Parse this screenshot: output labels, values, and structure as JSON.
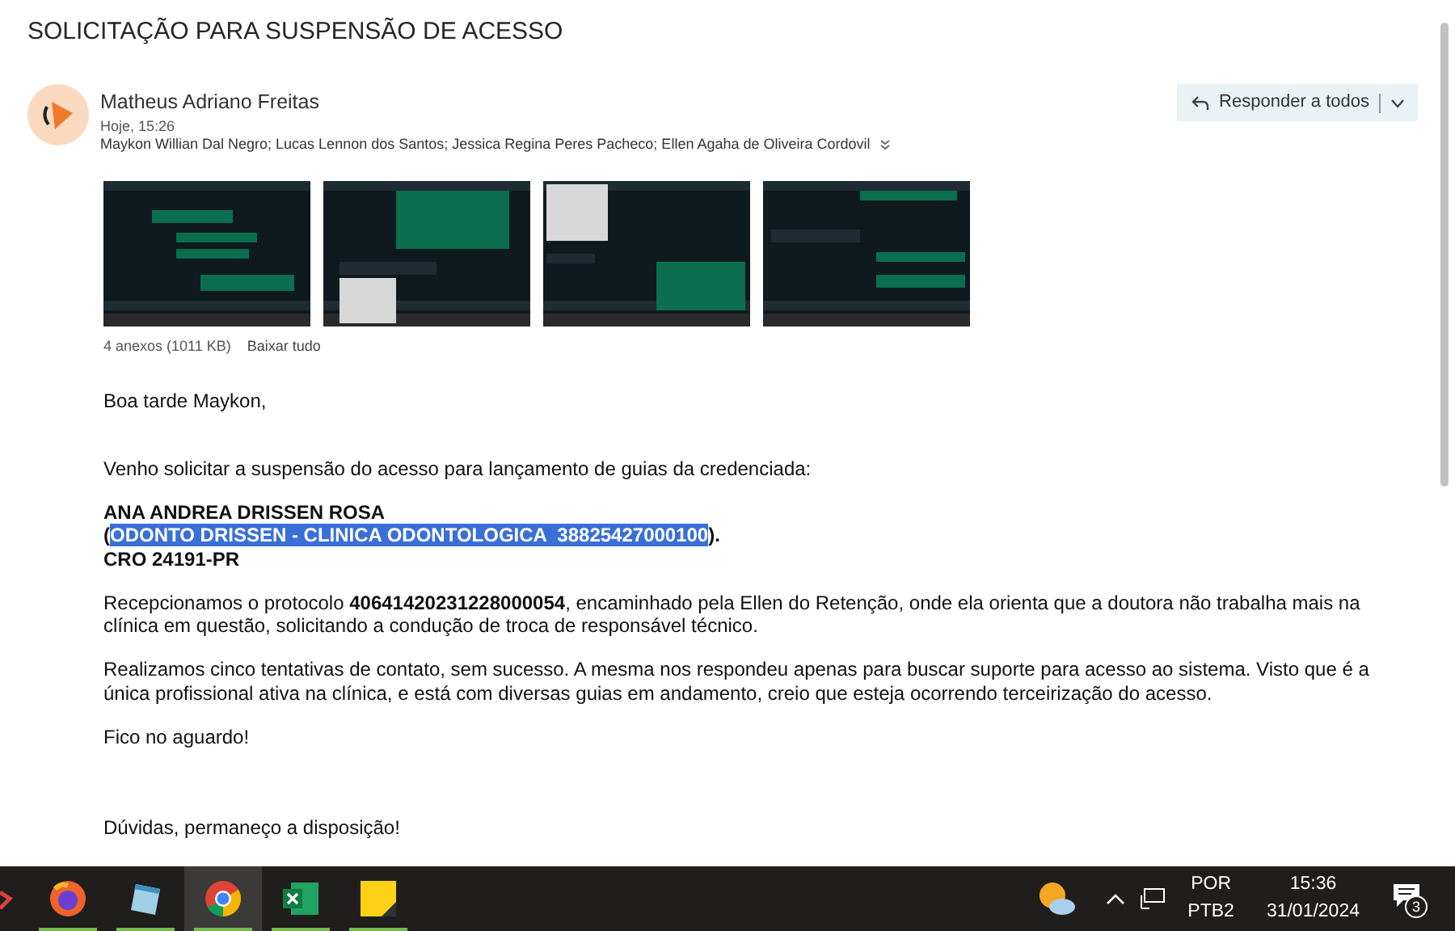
{
  "subject": "SOLICITAÇÃO PARA SUSPENSÃO DE ACESSO",
  "message": {
    "sender": "Matheus Adriano Freitas",
    "date": "Hoje, 15:26",
    "recipients": "Maykon Willian Dal Negro; Lucas Lennon dos Santos; Jessica Regina Peres Pacheco; Ellen Agaha de Oliveira Cordovil",
    "reply_button": "Responder a todos"
  },
  "attachments": {
    "count": "4 anexos (1011 KB)",
    "download_all": "Baixar tudo"
  },
  "body": [
    {
      "kind": "paragraph",
      "text": "Boa tarde Maykon,"
    },
    {
      "kind": "gap"
    },
    {
      "kind": "paragraph",
      "text": "Venho solicitar a suspensão do acesso para lançamento de guias da credenciada:"
    },
    {
      "kind": "block",
      "lines": [
        {
          "text": "ANA ANDREA DRISSEN ROSA"
        },
        {
          "prefix": "(",
          "highlighted": "ODONTO DRISSEN - CLINICA ODONTOLOGICA  38825427000100",
          "suffix": ")."
        },
        {
          "text": "CRO 24191-PR"
        }
      ]
    },
    {
      "kind": "paragraph",
      "text": "Recepcionamos o protocolo **40641420231228000054**, encaminhado pela Ellen do Retenção, onde ela orienta que a doutora não trabalha mais na clínica em questão, solicitando a condução de troca de responsável técnico."
    },
    {
      "kind": "paragraph",
      "text": "Realizamos cinco tentativas de contato, sem sucesso. A mesma nos respondeu apenas para buscar suporte para acesso ao sistema. Visto que é a única profissional ativa na clínica, e está com diversas guias em andamento, creio que esteja ocorrendo terceirização do acesso."
    },
    {
      "kind": "paragraph",
      "text": "Fico no aguardo!"
    },
    {
      "kind": "gap"
    },
    {
      "kind": "gap"
    },
    {
      "kind": "paragraph",
      "text": "Dúvidas, permaneço a disposição!"
    }
  ],
  "taskbar": {
    "apps": [
      {
        "kind": "partial",
        "running": false,
        "selected": false
      },
      {
        "kind": "firefox",
        "running": true,
        "selected": false
      },
      {
        "kind": "notepad",
        "running": true,
        "selected": false
      },
      {
        "kind": "chrome",
        "running": true,
        "selected": true
      },
      {
        "kind": "excel",
        "running": true,
        "selected": false
      },
      {
        "kind": "notes",
        "running": true,
        "selected": false
      }
    ],
    "language": "POR",
    "layout": "PTB2",
    "time": "15:36",
    "date": "31/01/2024",
    "notifications": "3"
  }
}
